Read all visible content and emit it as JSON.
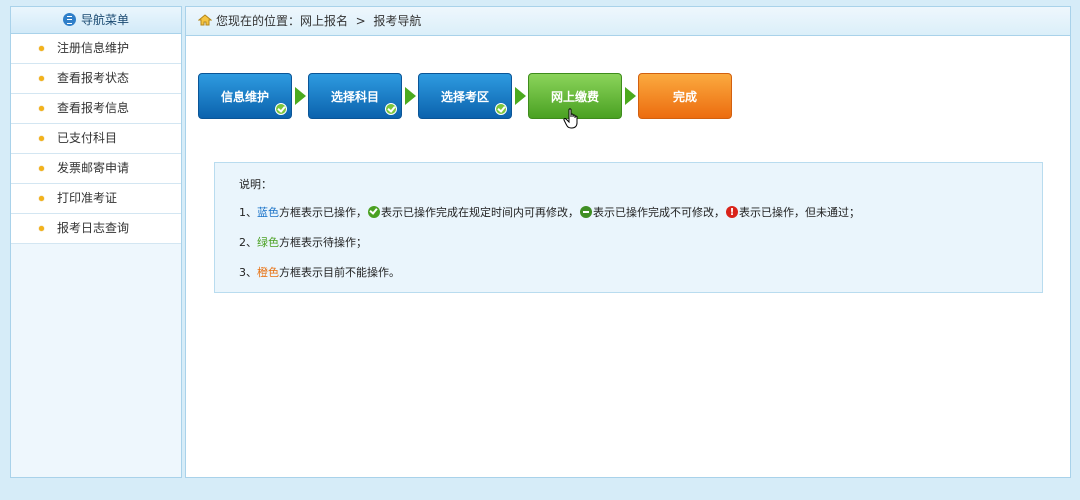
{
  "sidebar": {
    "title": "导航菜单",
    "items": [
      {
        "label": "注册信息维护"
      },
      {
        "label": "查看报考状态"
      },
      {
        "label": "查看报考信息"
      },
      {
        "label": "已支付科目"
      },
      {
        "label": "发票邮寄申请"
      },
      {
        "label": "打印准考证"
      },
      {
        "label": "报考日志查询"
      }
    ]
  },
  "breadcrumb": {
    "prefix": "您现在的位置：",
    "path1": "网上报名",
    "separator": ">",
    "path2": "报考导航"
  },
  "steps": [
    {
      "label": "信息维护",
      "state": "blue",
      "checked": true
    },
    {
      "label": "选择科目",
      "state": "blue",
      "checked": true
    },
    {
      "label": "选择考区",
      "state": "blue",
      "checked": true
    },
    {
      "label": "网上缴费",
      "state": "green",
      "checked": false
    },
    {
      "label": "完成",
      "state": "orange",
      "checked": false
    }
  ],
  "info": {
    "title": "说明：",
    "line1": {
      "prefix": "1、",
      "color_word": "蓝色",
      "text_a": "方框表示已操作，",
      "text_b": "表示已操作完成在规定时间内可再修改，",
      "text_c": "表示已操作完成不可修改，",
      "text_d": "表示已操作，但未通过；"
    },
    "line2": {
      "prefix": "2、",
      "color_word": "绿色",
      "text": "方框表示待操作；"
    },
    "line3": {
      "prefix": "3、",
      "color_word": "橙色",
      "text": "方框表示目前不能操作。"
    }
  },
  "colors": {
    "blue": "#0b62ad",
    "green": "#4aa122",
    "orange": "#ec6c0f",
    "background": "#d6ecf8"
  }
}
